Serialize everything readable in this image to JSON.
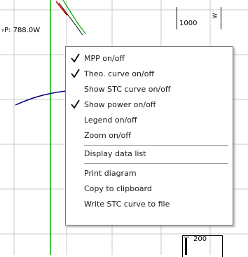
{
  "chart": {
    "mpp_readout": "›P: 788.0W",
    "power_tick": "1000",
    "power_unit": "W",
    "bottom_tick": "200"
  },
  "menu": {
    "items": [
      {
        "label": "MPP on/off",
        "checked": true
      },
      {
        "label": "Theo. curve on/off",
        "checked": true
      },
      {
        "label": "Show STC curve on/off",
        "checked": false
      },
      {
        "label": "Show power on/off",
        "checked": true
      },
      {
        "label": "Legend on/off",
        "checked": false
      },
      {
        "label": "Zoom on/off",
        "checked": false
      },
      {
        "label": "Display data list",
        "checked": false
      },
      {
        "label": "Print diagram",
        "checked": false
      },
      {
        "label": "Copy to clipboard",
        "checked": false
      },
      {
        "label": "Write STC curve to file",
        "checked": false
      }
    ]
  },
  "colors": {
    "grid": "#c8c8c8",
    "green_curve": "#00b000",
    "red_curve": "#d00000",
    "blue_curve": "#000080",
    "black_curve": "#000000",
    "check": "#000000"
  }
}
